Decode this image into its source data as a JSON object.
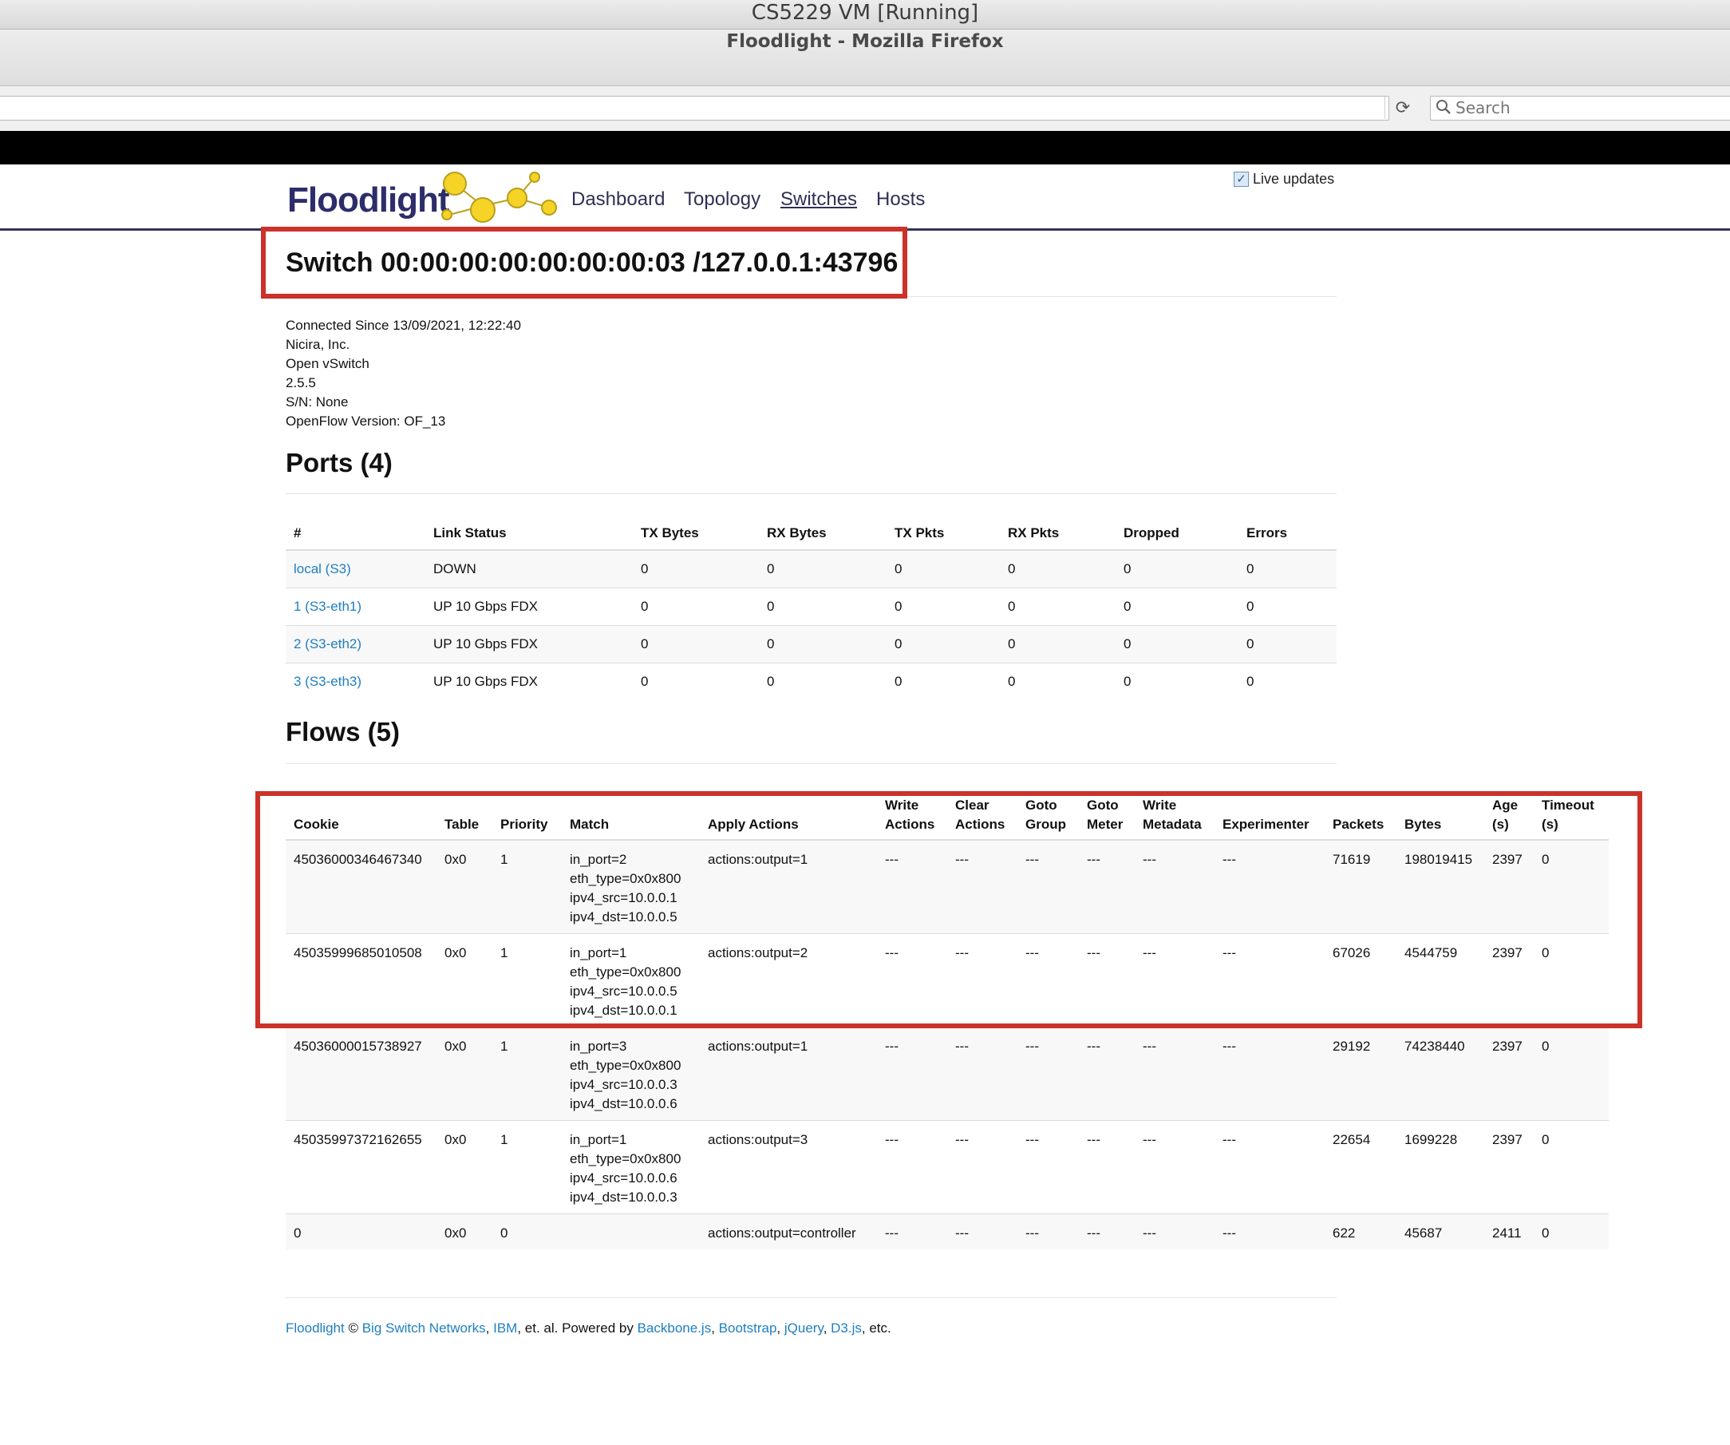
{
  "vm_window_title": "CS5229 VM [Running]",
  "browser": {
    "window_title": "Floodlight - Mozilla Firefox",
    "search_placeholder": "Search"
  },
  "header": {
    "logo_text": "Floodlight",
    "nav": [
      {
        "label": "Dashboard",
        "active": false
      },
      {
        "label": "Topology",
        "active": false
      },
      {
        "label": "Switches",
        "active": true
      },
      {
        "label": "Hosts",
        "active": false
      }
    ],
    "live_updates_label": "Live updates",
    "live_updates_checked": true
  },
  "switch": {
    "title": "Switch 00:00:00:00:00:00:00:03 /127.0.0.1:43796",
    "info": [
      "Connected Since 13/09/2021, 12:22:40",
      "Nicira, Inc.",
      "Open vSwitch",
      "2.5.5",
      "S/N: None",
      "OpenFlow Version: OF_13"
    ]
  },
  "ports": {
    "title": "Ports (4)",
    "columns": [
      "#",
      "Link Status",
      "TX Bytes",
      "RX Bytes",
      "TX Pkts",
      "RX Pkts",
      "Dropped",
      "Errors"
    ],
    "rows": [
      [
        "local (S3)",
        "DOWN",
        "0",
        "0",
        "0",
        "0",
        "0",
        "0"
      ],
      [
        "1 (S3-eth1)",
        "UP 10 Gbps FDX",
        "0",
        "0",
        "0",
        "0",
        "0",
        "0"
      ],
      [
        "2 (S3-eth2)",
        "UP 10 Gbps FDX",
        "0",
        "0",
        "0",
        "0",
        "0",
        "0"
      ],
      [
        "3 (S3-eth3)",
        "UP 10 Gbps FDX",
        "0",
        "0",
        "0",
        "0",
        "0",
        "0"
      ]
    ]
  },
  "flows": {
    "title": "Flows (5)",
    "columns": [
      [
        "Cookie"
      ],
      [
        "Table"
      ],
      [
        "Priority"
      ],
      [
        "Match"
      ],
      [
        "Apply Actions"
      ],
      [
        "Write",
        "Actions"
      ],
      [
        "Clear",
        "Actions"
      ],
      [
        "Goto",
        "Group"
      ],
      [
        "Goto",
        "Meter"
      ],
      [
        "Write",
        "Metadata"
      ],
      [
        "Experimenter"
      ],
      [
        "Packets"
      ],
      [
        "Bytes"
      ],
      [
        "Age",
        "(s)"
      ],
      [
        "Timeout",
        "(s)"
      ]
    ],
    "rows": [
      {
        "cookie": "45036000346467340",
        "table": "0x0",
        "priority": "1",
        "match": [
          "in_port=2",
          "eth_type=0x0x800",
          "ipv4_src=10.0.0.1",
          "ipv4_dst=10.0.0.5"
        ],
        "apply_actions": "actions:output=1",
        "write_actions": "---",
        "clear_actions": "---",
        "goto_group": "---",
        "goto_meter": "---",
        "write_metadata": "---",
        "experimenter": "---",
        "packets": "71619",
        "bytes": "198019415",
        "age": "2397",
        "timeout": "0"
      },
      {
        "cookie": "45035999685010508",
        "table": "0x0",
        "priority": "1",
        "match": [
          "in_port=1",
          "eth_type=0x0x800",
          "ipv4_src=10.0.0.5",
          "ipv4_dst=10.0.0.1"
        ],
        "apply_actions": "actions:output=2",
        "write_actions": "---",
        "clear_actions": "---",
        "goto_group": "---",
        "goto_meter": "---",
        "write_metadata": "---",
        "experimenter": "---",
        "packets": "67026",
        "bytes": "4544759",
        "age": "2397",
        "timeout": "0"
      },
      {
        "cookie": "45036000015738927",
        "table": "0x0",
        "priority": "1",
        "match": [
          "in_port=3",
          "eth_type=0x0x800",
          "ipv4_src=10.0.0.3",
          "ipv4_dst=10.0.0.6"
        ],
        "apply_actions": "actions:output=1",
        "write_actions": "---",
        "clear_actions": "---",
        "goto_group": "---",
        "goto_meter": "---",
        "write_metadata": "---",
        "experimenter": "---",
        "packets": "29192",
        "bytes": "74238440",
        "age": "2397",
        "timeout": "0"
      },
      {
        "cookie": "45035997372162655",
        "table": "0x0",
        "priority": "1",
        "match": [
          "in_port=1",
          "eth_type=0x0x800",
          "ipv4_src=10.0.0.6",
          "ipv4_dst=10.0.0.3"
        ],
        "apply_actions": "actions:output=3",
        "write_actions": "---",
        "clear_actions": "---",
        "goto_group": "---",
        "goto_meter": "---",
        "write_metadata": "---",
        "experimenter": "---",
        "packets": "22654",
        "bytes": "1699228",
        "age": "2397",
        "timeout": "0"
      },
      {
        "cookie": "0",
        "table": "0x0",
        "priority": "0",
        "match": [],
        "apply_actions": "actions:output=controller",
        "write_actions": "---",
        "clear_actions": "---",
        "goto_group": "---",
        "goto_meter": "---",
        "write_metadata": "---",
        "experimenter": "---",
        "packets": "622",
        "bytes": "45687",
        "age": "2411",
        "timeout": "0"
      }
    ]
  },
  "footer": {
    "parts": [
      {
        "text": "Floodlight",
        "link": true
      },
      {
        "text": " © ",
        "link": false
      },
      {
        "text": "Big Switch Networks",
        "link": true
      },
      {
        "text": ", ",
        "link": false
      },
      {
        "text": "IBM",
        "link": true
      },
      {
        "text": ", et. al. Powered by ",
        "link": false
      },
      {
        "text": "Backbone.js",
        "link": true
      },
      {
        "text": ", ",
        "link": false
      },
      {
        "text": "Bootstrap",
        "link": true
      },
      {
        "text": ", ",
        "link": false
      },
      {
        "text": "jQuery",
        "link": true
      },
      {
        "text": ", ",
        "link": false
      },
      {
        "text": "D3.js",
        "link": true
      },
      {
        "text": ", etc.",
        "link": false
      }
    ]
  },
  "colors": {
    "link": "#1f7fc1",
    "header_rule": "#34355a",
    "highlight_box": "#cc3229",
    "logo_dot": "#f5d327"
  }
}
